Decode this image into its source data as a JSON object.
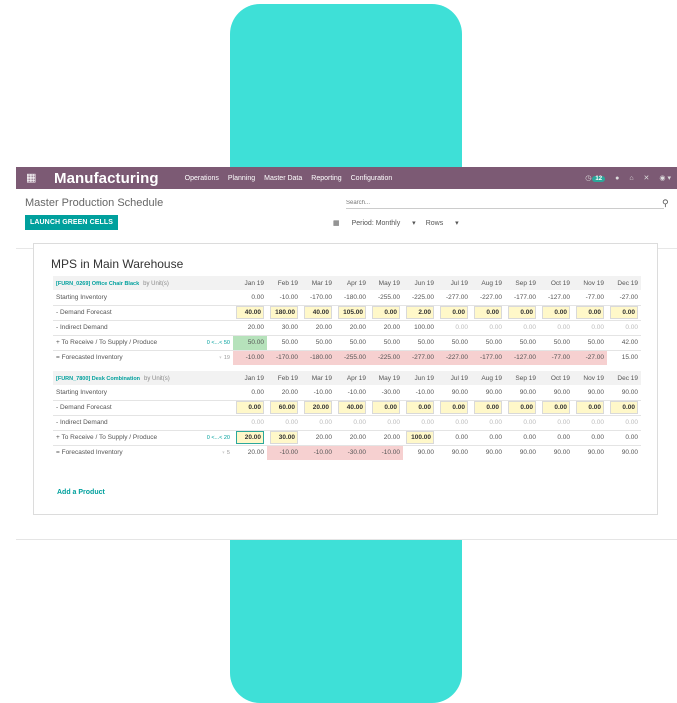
{
  "navbar": {
    "app_name": "Manufacturing",
    "menu": [
      "Operations",
      "Planning",
      "Master Data",
      "Reporting",
      "Configuration"
    ],
    "badge_count": "12"
  },
  "page": {
    "title": "Master Production Schedule",
    "launch_label": "LAUNCH GREEN CELLS",
    "search_placeholder": "Search...",
    "period_label": "Period: Monthly",
    "rows_label": "Rows",
    "sheet_title": "MPS in Main Warehouse",
    "add_product": "Add a Product"
  },
  "months": [
    "Jan 19",
    "Feb 19",
    "Mar 19",
    "Apr 19",
    "May 19",
    "Jun 19",
    "Jul 19",
    "Aug 19",
    "Sep 19",
    "Oct 19",
    "Nov 19",
    "Dec 19"
  ],
  "products": [
    {
      "name": "[FURN_0269] Office Chair Black",
      "uom": "by Unit(s)",
      "range": "0 <...< 50",
      "safety": "19",
      "rows": [
        {
          "label": "Starting Inventory",
          "values": [
            "0.00",
            "-10.00",
            "-170.00",
            "-180.00",
            "-255.00",
            "-225.00",
            "-277.00",
            "-227.00",
            "-177.00",
            "-127.00",
            "-77.00",
            "-27.00"
          ]
        },
        {
          "label": "-  Demand Forecast",
          "values": [
            "40.00",
            "180.00",
            "40.00",
            "105.00",
            "0.00",
            "2.00",
            "0.00",
            "0.00",
            "0.00",
            "0.00",
            "0.00",
            "0.00"
          ]
        },
        {
          "label": "-  Indirect Demand",
          "values": [
            "20.00",
            "30.00",
            "20.00",
            "20.00",
            "20.00",
            "100.00",
            "0.00",
            "0.00",
            "0.00",
            "0.00",
            "0.00",
            "0.00"
          ]
        },
        {
          "label": "+  To Receive / To Supply / Produce",
          "values": [
            "50.00",
            "50.00",
            "50.00",
            "50.00",
            "50.00",
            "50.00",
            "50.00",
            "50.00",
            "50.00",
            "50.00",
            "50.00",
            "42.00"
          ]
        },
        {
          "label": "=  Forecasted Inventory",
          "values": [
            "-10.00",
            "-170.00",
            "-180.00",
            "-255.00",
            "-225.00",
            "-277.00",
            "-227.00",
            "-177.00",
            "-127.00",
            "-77.00",
            "-27.00",
            "15.00"
          ]
        }
      ]
    },
    {
      "name": "[FURN_7800] Desk Combination",
      "uom": "by Unit(s)",
      "range": "0 <...< 20",
      "safety": "5",
      "rows": [
        {
          "label": "Starting Inventory",
          "values": [
            "0.00",
            "20.00",
            "-10.00",
            "-10.00",
            "-30.00",
            "-10.00",
            "90.00",
            "90.00",
            "90.00",
            "90.00",
            "90.00",
            "90.00"
          ]
        },
        {
          "label": "-  Demand Forecast",
          "values": [
            "0.00",
            "60.00",
            "20.00",
            "40.00",
            "0.00",
            "0.00",
            "0.00",
            "0.00",
            "0.00",
            "0.00",
            "0.00",
            "0.00"
          ]
        },
        {
          "label": "-  Indirect Demand",
          "values": [
            "0.00",
            "0.00",
            "0.00",
            "0.00",
            "0.00",
            "0.00",
            "0.00",
            "0.00",
            "0.00",
            "0.00",
            "0.00",
            "0.00"
          ]
        },
        {
          "label": "+  To Receive / To Supply / Produce",
          "values": [
            "20.00",
            "30.00",
            "20.00",
            "20.00",
            "20.00",
            "100.00",
            "0.00",
            "0.00",
            "0.00",
            "0.00",
            "0.00",
            "0.00"
          ]
        },
        {
          "label": "=  Forecasted Inventory",
          "values": [
            "20.00",
            "-10.00",
            "-10.00",
            "-30.00",
            "-10.00",
            "90.00",
            "90.00",
            "90.00",
            "90.00",
            "90.00",
            "90.00",
            "90.00"
          ]
        }
      ]
    }
  ],
  "colors": {
    "navbar": "#7c5a74",
    "accent": "#00a09d",
    "deco": "#3ee0d7",
    "negative": "#f6d0d0",
    "launch": "#b6e2bb",
    "editable": "#fff8c9"
  }
}
